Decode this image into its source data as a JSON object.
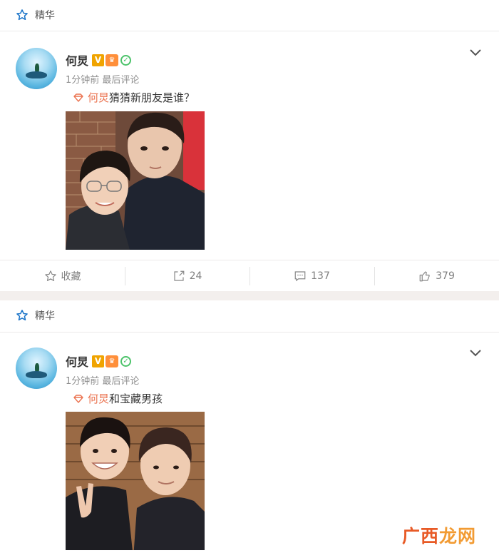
{
  "posts": [
    {
      "section_label": "精华",
      "username": "何炅",
      "badge_v": "V",
      "meta": "1分钟前 最后评论",
      "mention": "何炅",
      "text": "猜猜新朋友是谁？",
      "actions": {
        "favorite": "收藏",
        "repost": "24",
        "comment": "137",
        "like": "379"
      }
    },
    {
      "section_label": "精华",
      "username": "何炅",
      "badge_v": "V",
      "meta": "1分钟前 最后评论",
      "mention": "何炅",
      "text": "和宝藏男孩"
    }
  ],
  "watermark": {
    "part1": "广西",
    "part2": "龙网"
  },
  "colors": {
    "mention": "#eb7350",
    "vip": "#f0a400",
    "verified": "#4cc36a",
    "accent_star": "#1a73c8"
  }
}
